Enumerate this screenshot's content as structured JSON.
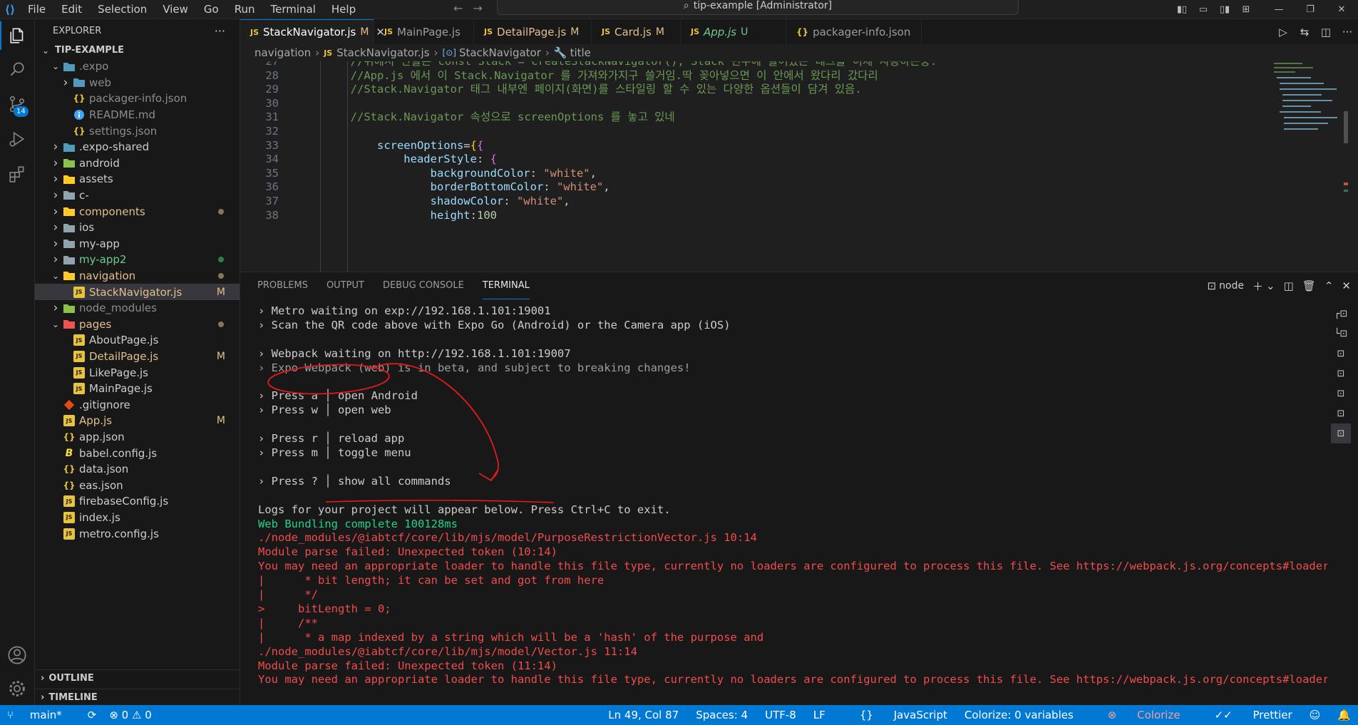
{
  "titlebar": {
    "menu": [
      "File",
      "Edit",
      "Selection",
      "View",
      "Go",
      "Run",
      "Terminal",
      "Help"
    ],
    "search_text": "tip-example [Administrator]"
  },
  "activity": {
    "scm_badge": "14"
  },
  "sidebar": {
    "header": "EXPLORER",
    "tree": [
      {
        "label": "TIP-EXAMPLE",
        "depth": 0,
        "kind": "root",
        "expanded": true
      },
      {
        "label": ".expo",
        "depth": 1,
        "kind": "folder",
        "expanded": true,
        "color": "#8c8c8c",
        "icon": "#519aba"
      },
      {
        "label": "web",
        "depth": 2,
        "kind": "folder",
        "expanded": false,
        "color": "#8c8c8c",
        "icon": "#519aba"
      },
      {
        "label": "packager-info.json",
        "depth": 2,
        "kind": "json",
        "color": "#8c8c8c"
      },
      {
        "label": "README.md",
        "depth": 2,
        "kind": "info",
        "color": "#8c8c8c"
      },
      {
        "label": "settings.json",
        "depth": 2,
        "kind": "json",
        "color": "#8c8c8c"
      },
      {
        "label": ".expo-shared",
        "depth": 1,
        "kind": "folder",
        "expanded": false,
        "icon": "#519aba"
      },
      {
        "label": "android",
        "depth": 1,
        "kind": "folder",
        "expanded": false,
        "icon": "#8bc34a"
      },
      {
        "label": "assets",
        "depth": 1,
        "kind": "folder",
        "expanded": false,
        "icon": "#ffca28"
      },
      {
        "label": "c-",
        "depth": 1,
        "kind": "folder",
        "expanded": false,
        "icon": "#90a4ae"
      },
      {
        "label": "components",
        "depth": 1,
        "kind": "folder",
        "expanded": false,
        "color": "#e2c08d",
        "icon": "#ffca28",
        "dot": "#887658"
      },
      {
        "label": "ios",
        "depth": 1,
        "kind": "folder",
        "expanded": false,
        "icon": "#90a4ae"
      },
      {
        "label": "my-app",
        "depth": 1,
        "kind": "folder",
        "expanded": false,
        "icon": "#90a4ae"
      },
      {
        "label": "my-app2",
        "depth": 1,
        "kind": "folder",
        "expanded": false,
        "color": "#73c991",
        "icon": "#90a4ae",
        "dot": "#2e7d4f"
      },
      {
        "label": "navigation",
        "depth": 1,
        "kind": "folder",
        "expanded": true,
        "color": "#e2c08d",
        "icon": "#ffca28",
        "dot": "#887658"
      },
      {
        "label": "StackNavigator.js",
        "depth": 2,
        "kind": "js",
        "color": "#e2c08d",
        "flag": "M",
        "selected": true
      },
      {
        "label": "node_modules",
        "depth": 1,
        "kind": "folder",
        "expanded": false,
        "color": "#8c8c8c",
        "icon": "#8bc34a"
      },
      {
        "label": "pages",
        "depth": 1,
        "kind": "folder",
        "expanded": true,
        "color": "#e2c08d",
        "icon": "#ef5350",
        "dot": "#887658"
      },
      {
        "label": "AboutPage.js",
        "depth": 2,
        "kind": "js"
      },
      {
        "label": "DetailPage.js",
        "depth": 2,
        "kind": "js",
        "color": "#e2c08d",
        "flag": "M"
      },
      {
        "label": "LikePage.js",
        "depth": 2,
        "kind": "js"
      },
      {
        "label": "MainPage.js",
        "depth": 2,
        "kind": "js"
      },
      {
        "label": ".gitignore",
        "depth": 1,
        "kind": "git"
      },
      {
        "label": "App.js",
        "depth": 1,
        "kind": "js",
        "color": "#e2c08d",
        "flag": "M"
      },
      {
        "label": "app.json",
        "depth": 1,
        "kind": "json"
      },
      {
        "label": "babel.config.js",
        "depth": 1,
        "kind": "babel"
      },
      {
        "label": "data.json",
        "depth": 1,
        "kind": "json"
      },
      {
        "label": "eas.json",
        "depth": 1,
        "kind": "json"
      },
      {
        "label": "firebaseConfig.js",
        "depth": 1,
        "kind": "js"
      },
      {
        "label": "index.js",
        "depth": 1,
        "kind": "js"
      },
      {
        "label": "metro.config.js",
        "depth": 1,
        "kind": "js"
      }
    ],
    "sections": [
      "OUTLINE",
      "TIMELINE"
    ]
  },
  "tabs": [
    {
      "label": "StackNavigator.js",
      "flag": "M",
      "active": true,
      "color": "#e2c08d"
    },
    {
      "label": "MainPage.js",
      "flag": "",
      "active": false,
      "color": "#9d9d9d"
    },
    {
      "label": "DetailPage.js",
      "flag": "M",
      "active": false,
      "color": "#e2c08d"
    },
    {
      "label": "Card.js",
      "flag": "M",
      "active": false,
      "color": "#e2c08d"
    },
    {
      "label": "App.js",
      "flag": "U",
      "active": false,
      "color": "#73c991",
      "italic": true
    },
    {
      "label": "packager-info.json",
      "flag": "",
      "active": false,
      "color": "#9d9d9d",
      "json": true
    }
  ],
  "breadcrumb": [
    "navigation",
    "StackNavigator.js",
    "StackNavigator",
    "title"
  ],
  "editor": {
    "lines": [
      {
        "n": "27",
        "parts": [
          {
            "t": "        //위에서 만들은 const Stack = createStackNavigator(); Stack 변수에 들어있는 태그를 이제 사용하는중.",
            "c": "cm"
          }
        ]
      },
      {
        "n": "28",
        "parts": [
          {
            "t": "        //App.js 에서 이 Stack.Navigator 를 가져와가지구 쓸거임.딱 꽂아넣으면 이 안에서 왔다리 갔다리",
            "c": "cm"
          }
        ]
      },
      {
        "n": "29",
        "parts": [
          {
            "t": "        //Stack.Navigator 태그 내부엔 페이지(화면)를 스타일링 할 수 있는 다양한 옵션들이 담겨 있음.",
            "c": "cm"
          }
        ]
      },
      {
        "n": "30",
        "parts": []
      },
      {
        "n": "31",
        "parts": [
          {
            "t": "        //Stack.Navigator 속성으로 screenOptions 를 놓고 있네",
            "c": "cm"
          }
        ]
      },
      {
        "n": "32",
        "parts": []
      },
      {
        "n": "33",
        "parts": [
          {
            "t": "            screenOptions",
            "c": "kw"
          },
          {
            "t": "=",
            "c": ""
          },
          {
            "t": "{",
            "c": "br1"
          },
          {
            "t": "{",
            "c": "br2"
          }
        ]
      },
      {
        "n": "34",
        "parts": [
          {
            "t": "                headerStyle",
            "c": "kw"
          },
          {
            "t": ": ",
            "c": ""
          },
          {
            "t": "{",
            "c": "br2"
          }
        ]
      },
      {
        "n": "35",
        "parts": [
          {
            "t": "                    backgroundColor",
            "c": "kw"
          },
          {
            "t": ": ",
            "c": ""
          },
          {
            "t": "\"white\"",
            "c": "str"
          },
          {
            "t": ",",
            "c": ""
          }
        ]
      },
      {
        "n": "36",
        "parts": [
          {
            "t": "                    borderBottomColor",
            "c": "kw"
          },
          {
            "t": ": ",
            "c": ""
          },
          {
            "t": "\"white\"",
            "c": "str"
          },
          {
            "t": ",",
            "c": ""
          }
        ]
      },
      {
        "n": "37",
        "parts": [
          {
            "t": "                    shadowColor",
            "c": "kw"
          },
          {
            "t": ": ",
            "c": ""
          },
          {
            "t": "\"white\"",
            "c": "str"
          },
          {
            "t": ",",
            "c": ""
          }
        ]
      },
      {
        "n": "38",
        "parts": [
          {
            "t": "                    height",
            "c": "kw"
          },
          {
            "t": ":",
            "c": ""
          },
          {
            "t": "100",
            "c": "num"
          }
        ]
      }
    ]
  },
  "panel": {
    "tabs": [
      "PROBLEMS",
      "OUTPUT",
      "DEBUG CONSOLE",
      "TERMINAL"
    ],
    "active_tab": "TERMINAL",
    "terminal_name": "node",
    "terminal": [
      {
        "t": "› Metro waiting on exp://192.168.1.101:19001",
        "c": ""
      },
      {
        "t": "› Scan the QR code above with Expo Go (Android) or the Camera app (iOS)",
        "c": ""
      },
      {
        "t": "",
        "c": ""
      },
      {
        "t": "› Webpack waiting on http://192.168.1.101:19007",
        "c": ""
      },
      {
        "t": "› Expo Webpack (web) is in beta, and subject to breaking changes!",
        "c": "dim"
      },
      {
        "t": "",
        "c": ""
      },
      {
        "t": "› Press a │ open Android",
        "c": ""
      },
      {
        "t": "› Press w │ open web",
        "c": ""
      },
      {
        "t": "",
        "c": ""
      },
      {
        "t": "› Press r │ reload app",
        "c": ""
      },
      {
        "t": "› Press m │ toggle menu",
        "c": ""
      },
      {
        "t": "",
        "c": ""
      },
      {
        "t": "› Press ? │ show all commands",
        "c": ""
      },
      {
        "t": "",
        "c": ""
      },
      {
        "t": "Logs for your project will appear below. Press Ctrl+C to exit.",
        "c": ""
      },
      {
        "t": "Web Bundling complete 100128ms",
        "c": "grn"
      },
      {
        "t": "./node_modules/@iabtcf/core/lib/mjs/model/PurposeRestrictionVector.js 10:14",
        "c": "err"
      },
      {
        "t": "Module parse failed: Unexpected token (10:14)",
        "c": "err"
      },
      {
        "t": "You may need an appropriate loader to handle this file type, currently no loaders are configured to process this file. See https://webpack.js.org/concepts#loaders",
        "c": "err"
      },
      {
        "t": "|      * bit length; it can be set and got from here",
        "c": "err"
      },
      {
        "t": "|      */",
        "c": "err"
      },
      {
        "t": ">     bitLength = 0;",
        "c": "err"
      },
      {
        "t": "|     /**",
        "c": "err"
      },
      {
        "t": "|      * a map indexed by a string which will be a 'hash' of the purpose and",
        "c": "err"
      },
      {
        "t": "./node_modules/@iabtcf/core/lib/mjs/model/Vector.js 11:14",
        "c": "err"
      },
      {
        "t": "Module parse failed: Unexpected token (11:14)",
        "c": "err"
      },
      {
        "t": "You may need an appropriate loader to handle this file type, currently no loaders are configured to process this file. See https://webpack.js.org/concepts#loaders",
        "c": "err"
      }
    ]
  },
  "statusbar": {
    "branch": "main*",
    "problems": "⊗ 0 ⚠ 0",
    "position": "Ln 49, Col 87",
    "spaces": "Spaces: 4",
    "encoding": "UTF-8",
    "eol": "LF",
    "language": "JavaScript",
    "colorize_vars": "Colorize: 0 variables",
    "colorize": "Colorize",
    "prettier": "Prettier"
  }
}
